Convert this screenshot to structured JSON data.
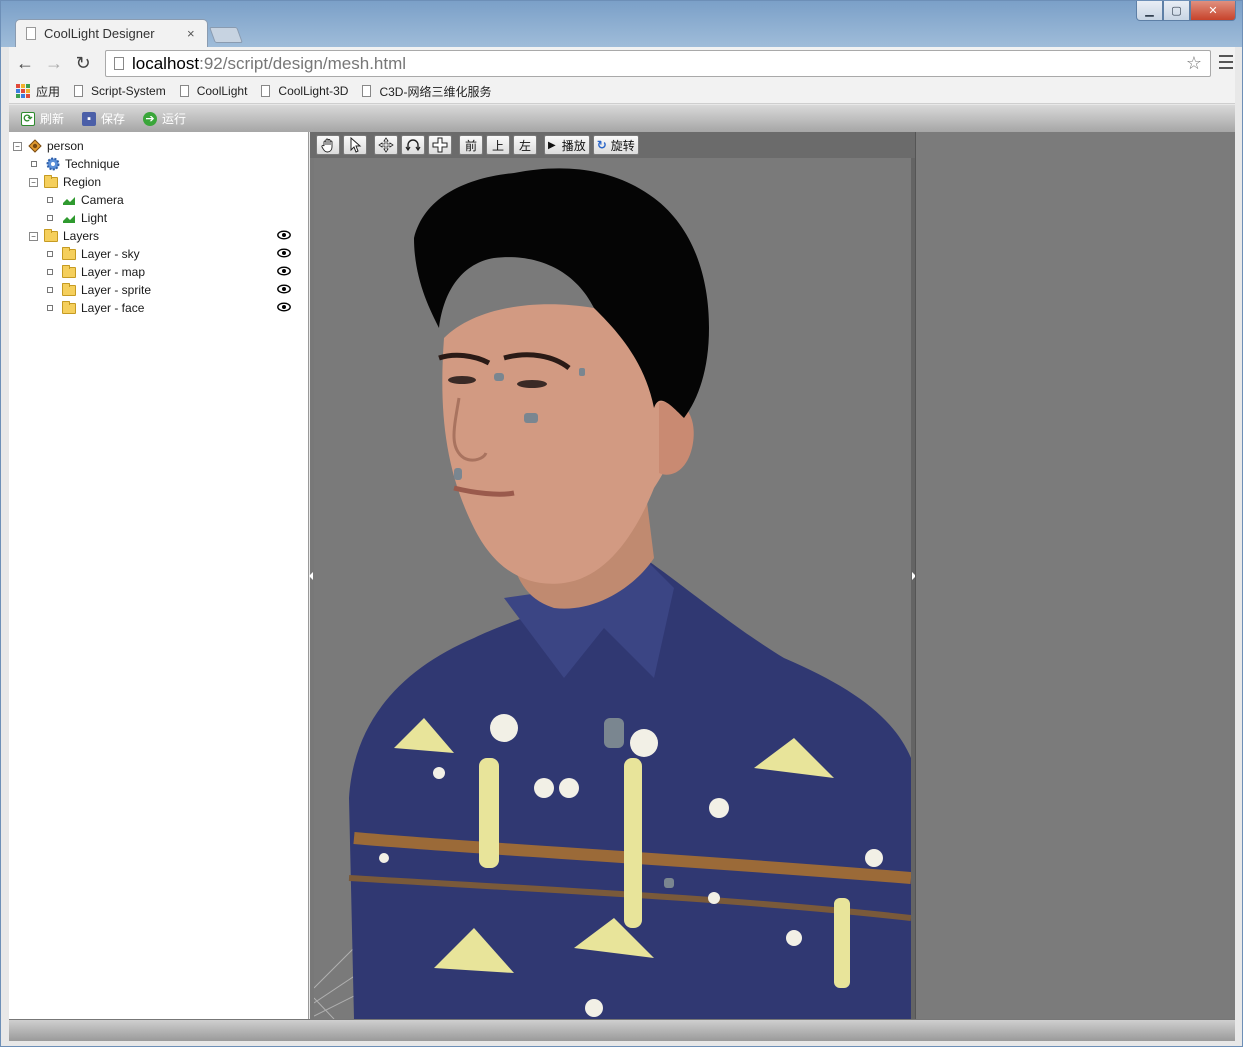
{
  "browser": {
    "tab_title": "CoolLight Designer",
    "tab_close": "×",
    "url_host": "localhost",
    "url_path": ":92/script/design/mesh.html",
    "star": "☆",
    "back": "←",
    "forward": "→",
    "reload": "↻"
  },
  "window_controls": {
    "minimize": "▁",
    "maximize": "▢",
    "close": "✕"
  },
  "bookmarks": {
    "apps_label": "应用",
    "items": [
      "Script-System",
      "CoolLight",
      "CoolLight-3D",
      "C3D-网络三维化服务"
    ]
  },
  "toolbar": {
    "refresh_label": "刷新",
    "save_label": "保存",
    "run_label": "运行"
  },
  "tree": {
    "root": "person",
    "technique": "Technique",
    "region": "Region",
    "camera": "Camera",
    "light": "Light",
    "layers": "Layers",
    "layer_items": [
      "Layer - sky",
      "Layer - map",
      "Layer - sprite",
      "Layer - face"
    ],
    "toggle_open": "−",
    "toggle_leaf": ""
  },
  "viewport_toolbar": {
    "front": "前",
    "top": "上",
    "left": "左",
    "play": "播放",
    "play_icon": "▶",
    "rotate": "旋转",
    "rotate_icon": "↻"
  },
  "colors": {
    "hair": "#050505",
    "skin": "#d29a82",
    "shirt": "#303872",
    "pattern": "#e8e49a",
    "stripe": "#9b6a38",
    "background": "#7a7a7a"
  }
}
